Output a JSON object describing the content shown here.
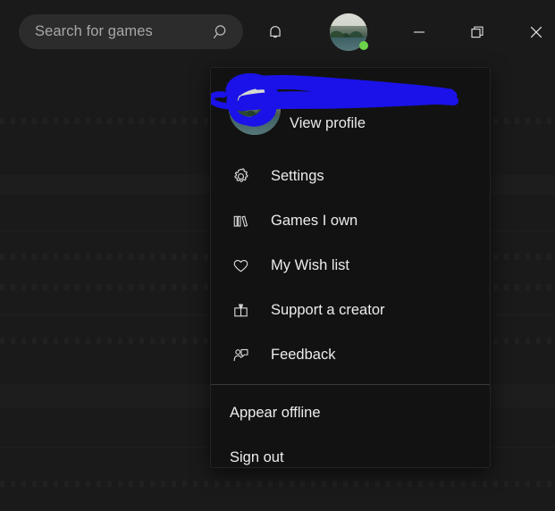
{
  "window": {
    "background_color": "#1a1a1a",
    "menu_background_color": "#121212",
    "accent_redaction_color": "#1a12e8",
    "status_online_color": "#6cd44a"
  },
  "titlebar": {
    "search": {
      "placeholder": "Search for games",
      "value": "",
      "icon": "search-icon"
    },
    "notifications": {
      "label": "Notifications",
      "icon": "bell-icon"
    },
    "account": {
      "label": "Account",
      "icon": "avatar",
      "status": "online"
    },
    "controls": [
      {
        "name": "minimize",
        "label": "Minimize",
        "icon": "minimize-icon"
      },
      {
        "name": "restore",
        "label": "Restore",
        "icon": "restore-icon"
      },
      {
        "name": "close",
        "label": "Close",
        "icon": "close-icon"
      }
    ]
  },
  "account_menu": {
    "profile": {
      "username": "",
      "username_redacted": true,
      "view_profile_label": "View profile",
      "avatar_icon": "avatar"
    },
    "items": [
      {
        "label": "Settings",
        "icon": "gear-icon"
      },
      {
        "label": "Games I own",
        "icon": "books-icon"
      },
      {
        "label": "My Wish list",
        "icon": "heart-icon"
      },
      {
        "label": "Support a creator",
        "icon": "gift-icon"
      },
      {
        "label": "Feedback",
        "icon": "feedback-icon"
      }
    ],
    "footer_items": [
      {
        "label": "Appear offline",
        "icon": ""
      },
      {
        "label": "Sign out",
        "icon": ""
      }
    ]
  }
}
